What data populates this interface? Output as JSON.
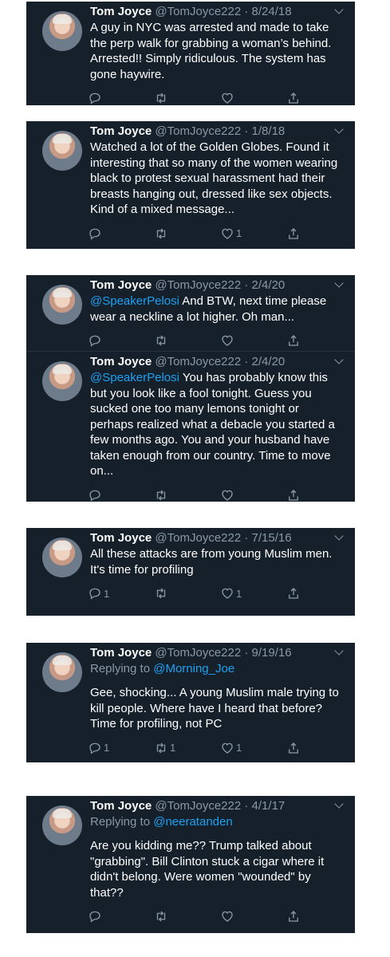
{
  "tweets": [
    {
      "name": "Tom Joyce",
      "handle": "@TomJoyce222",
      "date": "8/24/18",
      "replying_label": "",
      "replying_to": "",
      "mention": "",
      "text": "A guy in NYC was arrested and made to take the perp walk for grabbing a woman’s behind. Arrested!! Simply ridiculous. The system has gone haywire.",
      "replies": "",
      "retweets": "",
      "likes": ""
    },
    {
      "name": "Tom Joyce",
      "handle": "@TomJoyce222",
      "date": "1/8/18",
      "replying_label": "",
      "replying_to": "",
      "mention": "",
      "text": "Watched a lot of the Golden Globes. Found it interesting that so many of the women wearing black to protest sexual harassment had their breasts hanging out, dressed like sex objects. Kind of a mixed message...",
      "replies": "",
      "retweets": "",
      "likes": "1"
    },
    {
      "name": "Tom Joyce",
      "handle": "@TomJoyce222",
      "date": "2/4/20",
      "replying_label": "",
      "replying_to": "",
      "mention": "@SpeakerPelosi",
      "text": " And BTW, next time please wear a neckline a lot higher. Oh man...",
      "replies": "",
      "retweets": "",
      "likes": ""
    },
    {
      "name": "Tom Joyce",
      "handle": "@TomJoyce222",
      "date": "2/4/20",
      "replying_label": "",
      "replying_to": "",
      "mention": "@SpeakerPelosi",
      "text": "  You has probably know this but you look like a fool tonight. Guess you sucked one too many lemons tonight or perhaps realized what a debacle you started a few months ago. You and your husband have taken enough from our country. Time to move on...",
      "replies": "",
      "retweets": "",
      "likes": ""
    },
    {
      "name": "Tom Joyce",
      "handle": "@TomJoyce222",
      "date": "7/15/16",
      "replying_label": "",
      "replying_to": "",
      "mention": "",
      "text": "All these attacks are from young Muslim men. It's time for profiling",
      "replies": "1",
      "retweets": "",
      "likes": "1"
    },
    {
      "name": "Tom Joyce",
      "handle": "@TomJoyce222",
      "date": "9/19/16",
      "replying_label": "Replying to",
      "replying_to": "@Morning_Joe",
      "mention": "",
      "text": "Gee, shocking... A young Muslim male trying to kill people. Where have I heard that before? Time for profiling, not PC",
      "replies": "1",
      "retweets": "1",
      "likes": "1"
    },
    {
      "name": "Tom Joyce",
      "handle": "@TomJoyce222",
      "date": "4/1/17",
      "replying_label": "Replying to",
      "replying_to": "@neeratanden",
      "mention": "",
      "text": "Are you kidding me?? Trump talked about \"grabbing\". Bill Clinton stuck a cigar where it didn't belong. Were women \"wounded\" by that??",
      "replies": "",
      "retweets": "",
      "likes": ""
    }
  ],
  "separator": " · ",
  "colors": {
    "card_bg": "#15202b",
    "text": "#ffffff",
    "muted": "#8899a6",
    "link": "#1da1f2",
    "page_bg": "#ffffff"
  },
  "icons": {
    "reply": "reply-icon",
    "retweet": "retweet-icon",
    "like": "heart-icon",
    "share": "share-icon",
    "menu": "chevron-down-icon"
  }
}
